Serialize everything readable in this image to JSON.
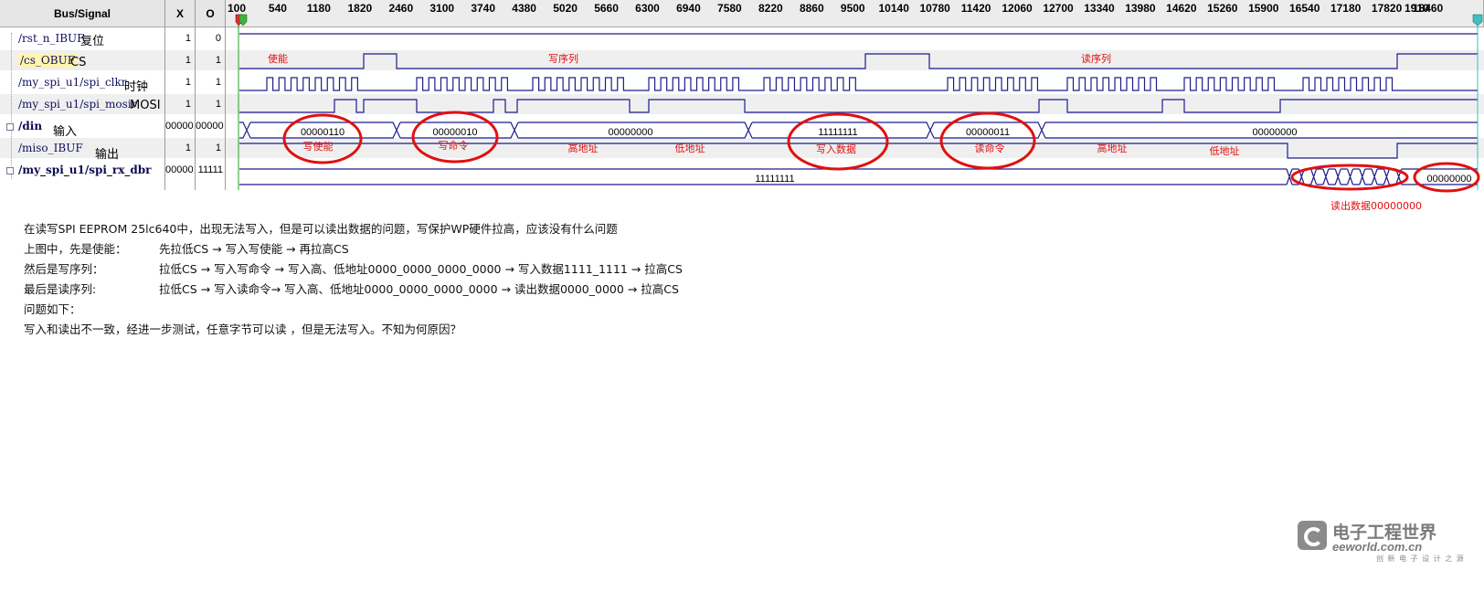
{
  "headers": {
    "signal": "Bus/Signal",
    "x": "X",
    "o": "O"
  },
  "timeline": [
    "100",
    "540",
    "1180",
    "1820",
    "2460",
    "3100",
    "3740",
    "4380",
    "5020",
    "5660",
    "6300",
    "6940",
    "7580",
    "8220",
    "8860",
    "9500",
    "10140",
    "10780",
    "11420",
    "12060",
    "12700",
    "13340",
    "13980",
    "14620",
    "15260",
    "15900",
    "16540",
    "17180",
    "17820",
    "18460",
    "1910"
  ],
  "signals": [
    {
      "name": "/rst_n_IBUF",
      "note": "复位",
      "x": "1",
      "o": "0"
    },
    {
      "name": "/cs_OBUF",
      "note": "CS",
      "x": "1",
      "o": "1"
    },
    {
      "name": "/my_spi_u1/spi_clkr",
      "note": "时钟",
      "x": "1",
      "o": "1"
    },
    {
      "name": "/my_spi_u1/spi_mosir",
      "note": "MOSI",
      "x": "1",
      "o": "1"
    },
    {
      "name": "/din",
      "note": "输入",
      "x": "00000",
      "o": "00000"
    },
    {
      "name": "/miso_IBUF",
      "note": "输出",
      "x": "1",
      "o": "1"
    },
    {
      "name": "/my_spi_u1/spi_rx_dbr",
      "note": "",
      "x": "00000",
      "o": "11111"
    }
  ],
  "annotations": {
    "enable": "使能",
    "write_seq": "写序列",
    "read_seq": "读序列",
    "din_values": [
      "00000110",
      "00000010",
      "00000000",
      "11111111",
      "00000011",
      "00000000"
    ],
    "din_labels": [
      "写使能",
      "写命令",
      "高地址",
      "低地址",
      "写入数据",
      "读命令",
      "高地址",
      "低地址"
    ],
    "rx_values": [
      "11111111",
      "00000000"
    ],
    "read_result": "读出数据00000000"
  },
  "text": {
    "line1": "在读写SPI EEPROM 25lc640中，出现无法写入，但是可以读出数据的问题，写保护WP硬件拉高，应该没有什么问题",
    "line2_label": "上图中，先是使能：",
    "line2_content": "先拉低CS → 写入写使能 → 再拉高CS",
    "line3_label": "然后是写序列：",
    "line3_content": "拉低CS → 写入写命令 → 写入高、低地址0000_0000_0000_0000   →   写入数据1111_1111 → 拉高CS",
    "line4_label": "最后是读序列:",
    "line4_content": "拉低CS → 写入读命令→ 写入高、低地址0000_0000_0000_0000    →   读出数据0000_0000 → 拉高CS",
    "line5": "问题如下：",
    "line6": "写入和读出不一致，经进一步测试，任意字节可以读    ，但是无法写入。不知为何原因？"
  },
  "logo": {
    "cn": "电子工程世界",
    "en": "eeworld.com.cn",
    "sub": "创 新 电 子 设 计 之 源"
  },
  "colors": {
    "wave": "#1c1c8c",
    "annotation": "#e01010",
    "header_bg": "#e6e6e6",
    "row_alt": "#efefef"
  }
}
